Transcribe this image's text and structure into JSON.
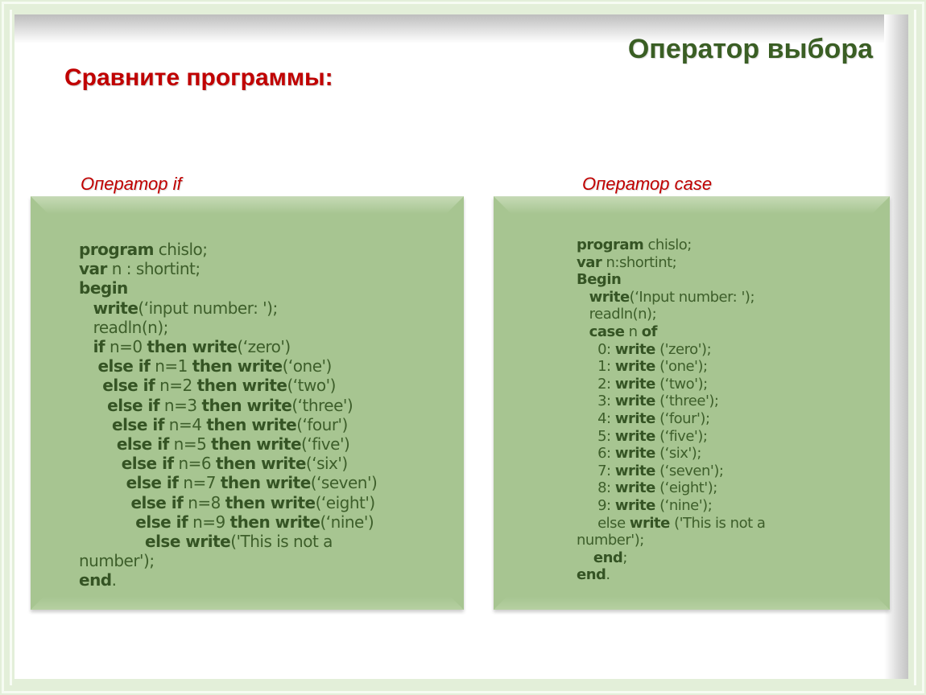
{
  "header": {
    "title": "Оператор выбора",
    "subtitle": "Сравните программы:"
  },
  "columns": {
    "left_label": "Оператор if",
    "right_label": "Оператор case"
  },
  "colors": {
    "title": "#3a5e24",
    "subtitle": "#c00000",
    "code_box": "#a7c591",
    "code_text": "#3d5e2a",
    "frame": "#e3efd9"
  },
  "if_program": [
    {
      "indent": "",
      "parts": [
        {
          "t": "program",
          "b": true
        },
        {
          "t": " chislo;"
        }
      ]
    },
    {
      "indent": "",
      "parts": [
        {
          "t": "var",
          "b": true
        },
        {
          "t": " n : shortint;"
        }
      ]
    },
    {
      "indent": "",
      "parts": [
        {
          "t": "begin",
          "b": true
        }
      ]
    },
    {
      "indent": "   ",
      "parts": [
        {
          "t": "write",
          "b": true
        },
        {
          "t": "(‘input number: ');"
        }
      ]
    },
    {
      "indent": "   ",
      "parts": [
        {
          "t": "readln(n);"
        }
      ]
    },
    {
      "indent": "   ",
      "parts": [
        {
          "t": "if",
          "b": true
        },
        {
          "t": " n=0 "
        },
        {
          "t": "then write",
          "b": true
        },
        {
          "t": "(‘zero')"
        }
      ]
    },
    {
      "indent": "    ",
      "parts": [
        {
          "t": "else if",
          "b": true
        },
        {
          "t": " n=1 "
        },
        {
          "t": "then write",
          "b": true
        },
        {
          "t": "(‘one')"
        }
      ]
    },
    {
      "indent": "     ",
      "parts": [
        {
          "t": "else if",
          "b": true
        },
        {
          "t": " n=2 "
        },
        {
          "t": "then write",
          "b": true
        },
        {
          "t": "(‘two')"
        }
      ]
    },
    {
      "indent": "      ",
      "parts": [
        {
          "t": "else if",
          "b": true
        },
        {
          "t": " n=3 "
        },
        {
          "t": "then write",
          "b": true
        },
        {
          "t": "(‘three')"
        }
      ]
    },
    {
      "indent": "       ",
      "parts": [
        {
          "t": "else if",
          "b": true
        },
        {
          "t": " n=4 "
        },
        {
          "t": "then write",
          "b": true
        },
        {
          "t": "(‘four')"
        }
      ]
    },
    {
      "indent": "        ",
      "parts": [
        {
          "t": "else if",
          "b": true
        },
        {
          "t": " n=5 "
        },
        {
          "t": "then write",
          "b": true
        },
        {
          "t": "(‘five')"
        }
      ]
    },
    {
      "indent": "         ",
      "parts": [
        {
          "t": "else if",
          "b": true
        },
        {
          "t": " n=6 "
        },
        {
          "t": "then write",
          "b": true
        },
        {
          "t": "(‘six')"
        }
      ]
    },
    {
      "indent": "          ",
      "parts": [
        {
          "t": "else if",
          "b": true
        },
        {
          "t": " n=7 "
        },
        {
          "t": "then write",
          "b": true
        },
        {
          "t": "(‘seven')"
        }
      ]
    },
    {
      "indent": "           ",
      "parts": [
        {
          "t": "else if",
          "b": true
        },
        {
          "t": " n=8 "
        },
        {
          "t": "then write",
          "b": true
        },
        {
          "t": "(‘eight')"
        }
      ]
    },
    {
      "indent": "            ",
      "parts": [
        {
          "t": "else if",
          "b": true
        },
        {
          "t": " n=9 "
        },
        {
          "t": "then write",
          "b": true
        },
        {
          "t": "(‘nine')"
        }
      ]
    },
    {
      "indent": "              ",
      "parts": [
        {
          "t": "else write",
          "b": true
        },
        {
          "t": "('This is not a"
        }
      ]
    },
    {
      "indent": "",
      "parts": [
        {
          "t": "number');"
        }
      ]
    },
    {
      "indent": "",
      "parts": [
        {
          "t": "end",
          "b": true
        },
        {
          "t": "."
        }
      ]
    }
  ],
  "case_program": [
    {
      "indent": "",
      "parts": [
        {
          "t": "program",
          "b": true
        },
        {
          "t": " chislo;"
        }
      ]
    },
    {
      "indent": "",
      "parts": [
        {
          "t": "var",
          "b": true
        },
        {
          "t": " n:shortint;"
        }
      ]
    },
    {
      "indent": "",
      "parts": [
        {
          "t": "Begin",
          "b": true
        }
      ]
    },
    {
      "indent": "   ",
      "parts": [
        {
          "t": "write",
          "b": true
        },
        {
          "t": "(‘Input number: ');"
        }
      ]
    },
    {
      "indent": "   ",
      "parts": [
        {
          "t": "readln(n);"
        }
      ]
    },
    {
      "indent": "   ",
      "parts": [
        {
          "t": "case",
          "b": true
        },
        {
          "t": " n "
        },
        {
          "t": "of",
          "b": true
        }
      ]
    },
    {
      "indent": "     ",
      "parts": [
        {
          "t": "0: "
        },
        {
          "t": "write",
          "b": true
        },
        {
          "t": " ('zero');"
        }
      ]
    },
    {
      "indent": "     ",
      "parts": [
        {
          "t": "1: "
        },
        {
          "t": "write",
          "b": true
        },
        {
          "t": " ('one');"
        }
      ]
    },
    {
      "indent": "     ",
      "parts": [
        {
          "t": "2: "
        },
        {
          "t": "write",
          "b": true
        },
        {
          "t": " (‘two');"
        }
      ]
    },
    {
      "indent": "     ",
      "parts": [
        {
          "t": "3: "
        },
        {
          "t": "write",
          "b": true
        },
        {
          "t": " (‘three');"
        }
      ]
    },
    {
      "indent": "     ",
      "parts": [
        {
          "t": "4: "
        },
        {
          "t": "write",
          "b": true
        },
        {
          "t": " (‘four');"
        }
      ]
    },
    {
      "indent": "     ",
      "parts": [
        {
          "t": "5: "
        },
        {
          "t": "write",
          "b": true
        },
        {
          "t": " (‘five');"
        }
      ]
    },
    {
      "indent": "     ",
      "parts": [
        {
          "t": "6: "
        },
        {
          "t": "write",
          "b": true
        },
        {
          "t": " (‘six');"
        }
      ]
    },
    {
      "indent": "     ",
      "parts": [
        {
          "t": "7: "
        },
        {
          "t": "write",
          "b": true
        },
        {
          "t": " (‘seven');"
        }
      ]
    },
    {
      "indent": "     ",
      "parts": [
        {
          "t": "8: "
        },
        {
          "t": "write",
          "b": true
        },
        {
          "t": " (‘eight');"
        }
      ]
    },
    {
      "indent": "     ",
      "parts": [
        {
          "t": "9: "
        },
        {
          "t": "write",
          "b": true
        },
        {
          "t": " (‘nine');"
        }
      ]
    },
    {
      "indent": "     ",
      "parts": [
        {
          "t": "else "
        },
        {
          "t": "write",
          "b": true
        },
        {
          "t": " ('This is not a"
        }
      ]
    },
    {
      "indent": "",
      "parts": [
        {
          "t": "number');"
        }
      ]
    },
    {
      "indent": "    ",
      "parts": [
        {
          "t": "end",
          "b": true
        },
        {
          "t": ";"
        }
      ]
    },
    {
      "indent": "",
      "parts": [
        {
          "t": "end",
          "b": true
        },
        {
          "t": "."
        }
      ]
    }
  ]
}
